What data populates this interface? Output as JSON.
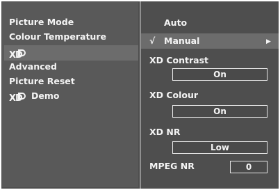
{
  "left_menu": {
    "items": [
      "Picture Mode",
      "Colour Temperature",
      "",
      "Advanced",
      "Picture Reset",
      "Demo"
    ],
    "xd_logo_text": "XD"
  },
  "right_menu": {
    "auto_label": "Auto",
    "manual_label": "Manual",
    "check_mark": "√",
    "submenu_arrow": "▶",
    "xd_contrast": {
      "label": "XD Contrast",
      "value": "On"
    },
    "xd_colour": {
      "label": "XD Colour",
      "value": "On"
    },
    "xd_nr": {
      "label": "XD NR",
      "value": "Low"
    },
    "mpeg_nr": {
      "label": "MPEG NR",
      "value": "0"
    }
  },
  "colors": {
    "background": "#4e4e4e",
    "panel": "#595959",
    "highlight": "#6c6c6c",
    "text": "#f4f4f4"
  }
}
